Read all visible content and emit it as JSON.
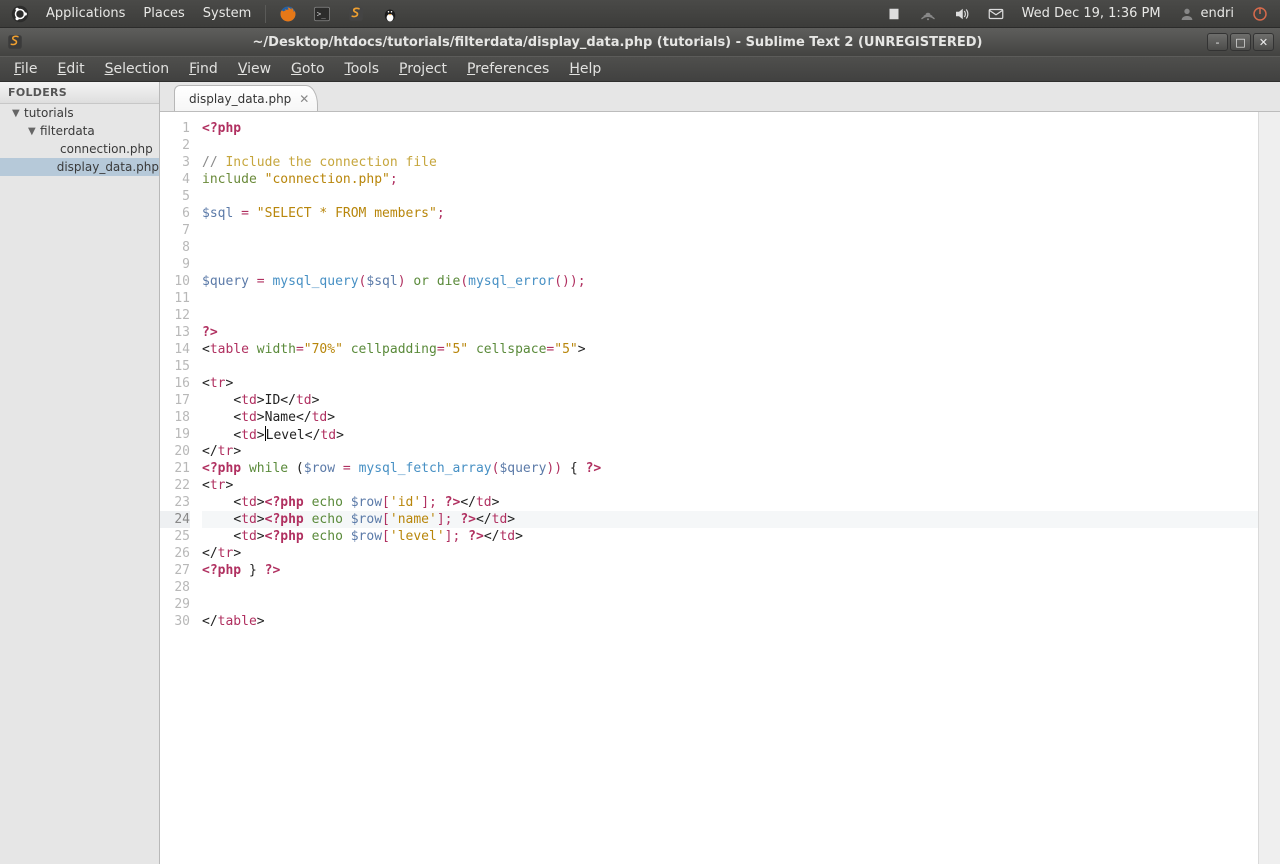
{
  "panel": {
    "menus": [
      "Applications",
      "Places",
      "System"
    ],
    "clock": "Wed Dec 19,  1:36 PM",
    "user": "endri"
  },
  "window": {
    "title": "~/Desktop/htdocs/tutorials/filterdata/display_data.php (tutorials) - Sublime Text 2 (UNREGISTERED)"
  },
  "menubar": [
    "File",
    "Edit",
    "Selection",
    "Find",
    "View",
    "Goto",
    "Tools",
    "Project",
    "Preferences",
    "Help"
  ],
  "sidebar": {
    "header": "FOLDERS",
    "tree": [
      {
        "level": 1,
        "arrow": "▼",
        "label": "tutorials"
      },
      {
        "level": 2,
        "arrow": "▼",
        "label": "filterdata"
      },
      {
        "level": 3,
        "arrow": "",
        "label": "connection.php"
      },
      {
        "level": 3,
        "arrow": "",
        "label": "display_data.php",
        "selected": true
      }
    ]
  },
  "tabs": [
    {
      "label": "display_data.php",
      "active": true
    }
  ],
  "highlighted_line": 24,
  "code": {
    "lines": [
      {
        "n": 1,
        "t": [
          [
            "kw",
            "<?php"
          ]
        ]
      },
      {
        "n": 2,
        "t": [
          [
            "",
            ""
          ]
        ]
      },
      {
        "n": 3,
        "t": [
          [
            "cmtS",
            "// "
          ],
          [
            "cmt",
            "Include the connection file"
          ]
        ]
      },
      {
        "n": 4,
        "t": [
          [
            "incl",
            "include "
          ],
          [
            "str",
            "\"connection.php\""
          ],
          [
            "op",
            ";"
          ]
        ]
      },
      {
        "n": 5,
        "t": [
          [
            "",
            ""
          ]
        ]
      },
      {
        "n": 6,
        "t": [
          [
            "var",
            "$sql"
          ],
          [
            "",
            " "
          ],
          [
            "op",
            "="
          ],
          [
            "",
            " "
          ],
          [
            "str",
            "\"SELECT * FROM members\""
          ],
          [
            "op",
            ";"
          ]
        ]
      },
      {
        "n": 7,
        "t": [
          [
            "",
            ""
          ]
        ]
      },
      {
        "n": 8,
        "t": [
          [
            "",
            ""
          ]
        ]
      },
      {
        "n": 9,
        "t": [
          [
            "",
            ""
          ]
        ]
      },
      {
        "n": 10,
        "t": [
          [
            "var",
            "$query"
          ],
          [
            "",
            " "
          ],
          [
            "op",
            "="
          ],
          [
            "",
            " "
          ],
          [
            "fn",
            "mysql_query"
          ],
          [
            "op",
            "("
          ],
          [
            "var",
            "$sql"
          ],
          [
            "op",
            ")"
          ],
          [
            "",
            " "
          ],
          [
            "kw2",
            "or"
          ],
          [
            "",
            " "
          ],
          [
            "kw2",
            "die"
          ],
          [
            "op",
            "("
          ],
          [
            "fn",
            "mysql_error"
          ],
          [
            "op",
            "());"
          ]
        ]
      },
      {
        "n": 11,
        "t": [
          [
            "",
            ""
          ]
        ]
      },
      {
        "n": 12,
        "t": [
          [
            "",
            ""
          ]
        ]
      },
      {
        "n": 13,
        "t": [
          [
            "kw",
            "?>"
          ]
        ]
      },
      {
        "n": 14,
        "t": [
          [
            "lt",
            "<"
          ],
          [
            "tagn",
            "table"
          ],
          [
            "",
            " "
          ],
          [
            "attr",
            "width"
          ],
          [
            "op",
            "="
          ],
          [
            "str",
            "\"70%\""
          ],
          [
            "",
            " "
          ],
          [
            "attr",
            "cellpadding"
          ],
          [
            "op",
            "="
          ],
          [
            "str",
            "\"5\""
          ],
          [
            "",
            " "
          ],
          [
            "attr",
            "cellspace"
          ],
          [
            "op",
            "="
          ],
          [
            "str",
            "\"5\""
          ],
          [
            "lt",
            ">"
          ]
        ]
      },
      {
        "n": 15,
        "t": [
          [
            "",
            ""
          ]
        ]
      },
      {
        "n": 16,
        "t": [
          [
            "lt",
            "<"
          ],
          [
            "tagn",
            "tr"
          ],
          [
            "lt",
            ">"
          ]
        ]
      },
      {
        "n": 17,
        "t": [
          [
            "",
            "    "
          ],
          [
            "lt",
            "<"
          ],
          [
            "tagn",
            "td"
          ],
          [
            "lt",
            ">"
          ],
          [
            "",
            "ID"
          ],
          [
            "lt",
            "</"
          ],
          [
            "tagn",
            "td"
          ],
          [
            "lt",
            ">"
          ]
        ]
      },
      {
        "n": 18,
        "t": [
          [
            "",
            "    "
          ],
          [
            "lt",
            "<"
          ],
          [
            "tagn",
            "td"
          ],
          [
            "lt",
            ">"
          ],
          [
            "",
            "Name"
          ],
          [
            "lt",
            "</"
          ],
          [
            "tagn",
            "td"
          ],
          [
            "lt",
            ">"
          ]
        ]
      },
      {
        "n": 19,
        "t": [
          [
            "",
            "    "
          ],
          [
            "lt",
            "<"
          ],
          [
            "tagn",
            "td"
          ],
          [
            "lt",
            ">"
          ],
          [
            "",
            "Level"
          ],
          [
            "lt",
            "</"
          ],
          [
            "tagn",
            "td"
          ],
          [
            "lt",
            ">"
          ]
        ],
        "cursor_after": 3
      },
      {
        "n": 20,
        "t": [
          [
            "lt",
            "</"
          ],
          [
            "tagn",
            "tr"
          ],
          [
            "lt",
            ">"
          ]
        ]
      },
      {
        "n": 21,
        "t": [
          [
            "kw",
            "<?php"
          ],
          [
            "",
            " "
          ],
          [
            "kw2",
            "while"
          ],
          [
            "",
            " ("
          ],
          [
            "var",
            "$row"
          ],
          [
            "",
            " "
          ],
          [
            "op",
            "="
          ],
          [
            "",
            " "
          ],
          [
            "fn",
            "mysql_fetch_array"
          ],
          [
            "op",
            "("
          ],
          [
            "var",
            "$query"
          ],
          [
            "op",
            "))"
          ],
          [
            "",
            " { "
          ],
          [
            "kw",
            "?>"
          ]
        ]
      },
      {
        "n": 22,
        "t": [
          [
            "lt",
            "<"
          ],
          [
            "tagn",
            "tr"
          ],
          [
            "lt",
            ">"
          ]
        ]
      },
      {
        "n": 23,
        "t": [
          [
            "",
            "    "
          ],
          [
            "lt",
            "<"
          ],
          [
            "tagn",
            "td"
          ],
          [
            "lt",
            ">"
          ],
          [
            "kw",
            "<?php"
          ],
          [
            "",
            " "
          ],
          [
            "kw2",
            "echo"
          ],
          [
            "",
            " "
          ],
          [
            "var",
            "$row"
          ],
          [
            "op",
            "["
          ],
          [
            "str",
            "'id'"
          ],
          [
            "op",
            "]; "
          ],
          [
            "kw",
            "?>"
          ],
          [
            "lt",
            "</"
          ],
          [
            "tagn",
            "td"
          ],
          [
            "lt",
            ">"
          ]
        ]
      },
      {
        "n": 24,
        "t": [
          [
            "",
            "    "
          ],
          [
            "lt",
            "<"
          ],
          [
            "tagn",
            "td"
          ],
          [
            "lt",
            ">"
          ],
          [
            "kw",
            "<?php"
          ],
          [
            "",
            " "
          ],
          [
            "kw2",
            "echo"
          ],
          [
            "",
            " "
          ],
          [
            "var",
            "$row"
          ],
          [
            "op",
            "["
          ],
          [
            "str",
            "'name'"
          ],
          [
            "op",
            "]; "
          ],
          [
            "kw",
            "?>"
          ],
          [
            "lt",
            "</"
          ],
          [
            "tagn",
            "td"
          ],
          [
            "lt",
            ">"
          ]
        ]
      },
      {
        "n": 25,
        "t": [
          [
            "",
            "    "
          ],
          [
            "lt",
            "<"
          ],
          [
            "tagn",
            "td"
          ],
          [
            "lt",
            ">"
          ],
          [
            "kw",
            "<?php"
          ],
          [
            "",
            " "
          ],
          [
            "kw2",
            "echo"
          ],
          [
            "",
            " "
          ],
          [
            "var",
            "$row"
          ],
          [
            "op",
            "["
          ],
          [
            "str",
            "'level'"
          ],
          [
            "op",
            "]; "
          ],
          [
            "kw",
            "?>"
          ],
          [
            "lt",
            "</"
          ],
          [
            "tagn",
            "td"
          ],
          [
            "lt",
            ">"
          ]
        ]
      },
      {
        "n": 26,
        "t": [
          [
            "lt",
            "</"
          ],
          [
            "tagn",
            "tr"
          ],
          [
            "lt",
            ">"
          ]
        ]
      },
      {
        "n": 27,
        "t": [
          [
            "kw",
            "<?php"
          ],
          [
            "",
            " } "
          ],
          [
            "kw",
            "?>"
          ]
        ]
      },
      {
        "n": 28,
        "t": [
          [
            "",
            ""
          ]
        ]
      },
      {
        "n": 29,
        "t": [
          [
            "",
            ""
          ]
        ]
      },
      {
        "n": 30,
        "t": [
          [
            "lt",
            "</"
          ],
          [
            "tagn",
            "table"
          ],
          [
            "lt",
            ">"
          ]
        ]
      }
    ]
  }
}
